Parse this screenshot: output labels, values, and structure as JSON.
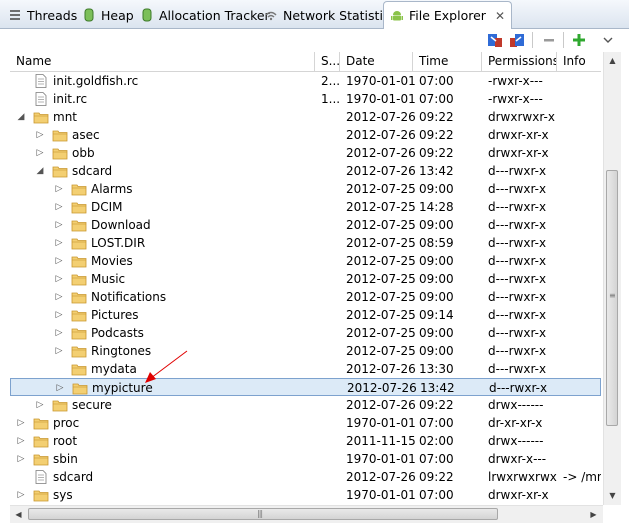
{
  "tabs": [
    {
      "label": "Threads",
      "icon": "threads-icon",
      "active": false
    },
    {
      "label": "Heap",
      "icon": "heap-icon",
      "active": false
    },
    {
      "label": "Allocation Tracker",
      "icon": "allocation-icon",
      "active": false
    },
    {
      "label": "Network Statistics",
      "icon": "wifi-icon",
      "active": false
    },
    {
      "label": "File Explorer",
      "icon": "android-icon",
      "active": true
    }
  ],
  "columns": [
    "Name",
    "S...",
    "Date",
    "Time",
    "Permissions",
    "Info"
  ],
  "rows": [
    {
      "name": "init.goldfish.rc",
      "size": "2...",
      "date": "1970-01-01",
      "time": "07:00",
      "perms": "-rwxr-x---",
      "info": "",
      "type": "file",
      "expand": "",
      "depth": 0
    },
    {
      "name": "init.rc",
      "size": "1...",
      "date": "1970-01-01",
      "time": "07:00",
      "perms": "-rwxr-x---",
      "info": "",
      "type": "file",
      "expand": "",
      "depth": 0
    },
    {
      "name": "mnt",
      "size": "",
      "date": "2012-07-26",
      "time": "09:22",
      "perms": "drwxrwxr-x",
      "info": "",
      "type": "folder",
      "expand": "open",
      "depth": 0
    },
    {
      "name": "asec",
      "size": "",
      "date": "2012-07-26",
      "time": "09:22",
      "perms": "drwxr-xr-x",
      "info": "",
      "type": "folder",
      "expand": "closed",
      "depth": 1
    },
    {
      "name": "obb",
      "size": "",
      "date": "2012-07-26",
      "time": "09:22",
      "perms": "drwxr-xr-x",
      "info": "",
      "type": "folder",
      "expand": "closed",
      "depth": 1
    },
    {
      "name": "sdcard",
      "size": "",
      "date": "2012-07-26",
      "time": "13:42",
      "perms": "d---rwxr-x",
      "info": "",
      "type": "folder",
      "expand": "open",
      "depth": 1
    },
    {
      "name": "Alarms",
      "size": "",
      "date": "2012-07-25",
      "time": "09:00",
      "perms": "d---rwxr-x",
      "info": "",
      "type": "folder",
      "expand": "closed",
      "depth": 2
    },
    {
      "name": "DCIM",
      "size": "",
      "date": "2012-07-25",
      "time": "14:28",
      "perms": "d---rwxr-x",
      "info": "",
      "type": "folder",
      "expand": "closed",
      "depth": 2
    },
    {
      "name": "Download",
      "size": "",
      "date": "2012-07-25",
      "time": "09:00",
      "perms": "d---rwxr-x",
      "info": "",
      "type": "folder",
      "expand": "closed",
      "depth": 2
    },
    {
      "name": "LOST.DIR",
      "size": "",
      "date": "2012-07-25",
      "time": "08:59",
      "perms": "d---rwxr-x",
      "info": "",
      "type": "folder",
      "expand": "closed",
      "depth": 2
    },
    {
      "name": "Movies",
      "size": "",
      "date": "2012-07-25",
      "time": "09:00",
      "perms": "d---rwxr-x",
      "info": "",
      "type": "folder",
      "expand": "closed",
      "depth": 2
    },
    {
      "name": "Music",
      "size": "",
      "date": "2012-07-25",
      "time": "09:00",
      "perms": "d---rwxr-x",
      "info": "",
      "type": "folder",
      "expand": "closed",
      "depth": 2
    },
    {
      "name": "Notifications",
      "size": "",
      "date": "2012-07-25",
      "time": "09:00",
      "perms": "d---rwxr-x",
      "info": "",
      "type": "folder",
      "expand": "closed",
      "depth": 2
    },
    {
      "name": "Pictures",
      "size": "",
      "date": "2012-07-25",
      "time": "09:14",
      "perms": "d---rwxr-x",
      "info": "",
      "type": "folder",
      "expand": "closed",
      "depth": 2
    },
    {
      "name": "Podcasts",
      "size": "",
      "date": "2012-07-25",
      "time": "09:00",
      "perms": "d---rwxr-x",
      "info": "",
      "type": "folder",
      "expand": "closed",
      "depth": 2
    },
    {
      "name": "Ringtones",
      "size": "",
      "date": "2012-07-25",
      "time": "09:00",
      "perms": "d---rwxr-x",
      "info": "",
      "type": "folder",
      "expand": "closed",
      "depth": 2
    },
    {
      "name": "mydata",
      "size": "",
      "date": "2012-07-26",
      "time": "13:30",
      "perms": "d---rwxr-x",
      "info": "",
      "type": "folder",
      "expand": "",
      "depth": 2
    },
    {
      "name": "mypicture",
      "size": "",
      "date": "2012-07-26",
      "time": "13:42",
      "perms": "d---rwxr-x",
      "info": "",
      "type": "folder",
      "expand": "closed",
      "depth": 2,
      "selected": true
    },
    {
      "name": "secure",
      "size": "",
      "date": "2012-07-26",
      "time": "09:22",
      "perms": "drwx------",
      "info": "",
      "type": "folder",
      "expand": "closed",
      "depth": 1
    },
    {
      "name": "proc",
      "size": "",
      "date": "1970-01-01",
      "time": "07:00",
      "perms": "dr-xr-xr-x",
      "info": "",
      "type": "folder",
      "expand": "closed",
      "depth": 0
    },
    {
      "name": "root",
      "size": "",
      "date": "2011-11-15",
      "time": "02:00",
      "perms": "drwx------",
      "info": "",
      "type": "folder",
      "expand": "closed",
      "depth": 0
    },
    {
      "name": "sbin",
      "size": "",
      "date": "1970-01-01",
      "time": "07:00",
      "perms": "drwxr-x---",
      "info": "",
      "type": "folder",
      "expand": "closed",
      "depth": 0
    },
    {
      "name": "sdcard",
      "size": "",
      "date": "2012-07-26",
      "time": "09:22",
      "perms": "lrwxrwxrwx",
      "info": "-> /mn",
      "type": "file",
      "expand": "",
      "depth": 0
    },
    {
      "name": "sys",
      "size": "",
      "date": "1970-01-01",
      "time": "07:00",
      "perms": "drwxr-xr-x",
      "info": "",
      "type": "folder",
      "expand": "closed",
      "depth": 0
    }
  ],
  "toolbar": [
    {
      "name": "pull-file-icon"
    },
    {
      "name": "push-file-icon"
    },
    {
      "name": "delete-icon"
    },
    {
      "name": "new-folder-icon"
    },
    {
      "name": "view-menu-icon"
    }
  ],
  "colors": {
    "accent": "#3399ff",
    "selection": "#dceaf7",
    "folder": "#e8b64c",
    "annotation": "#e00000"
  }
}
